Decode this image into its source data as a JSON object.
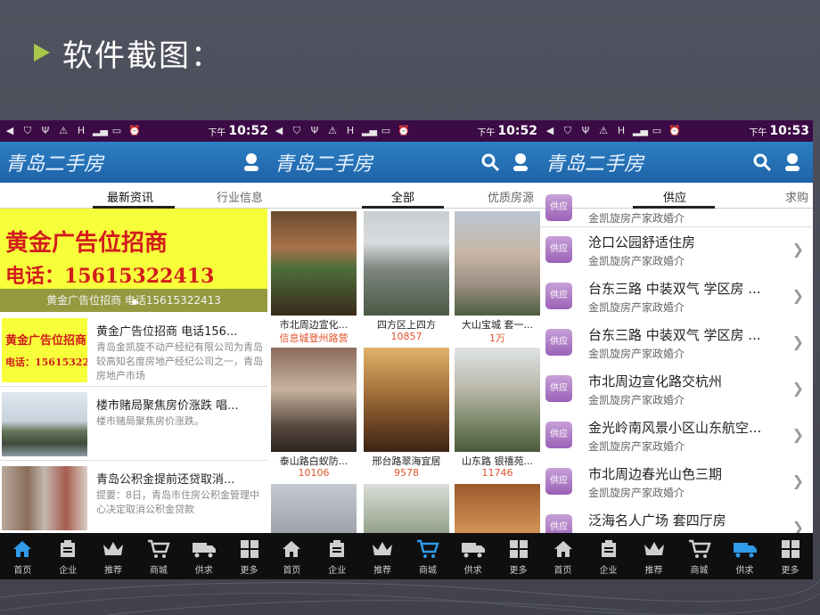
{
  "slide": {
    "title": "软件截图："
  },
  "status": {
    "ampm": "下午",
    "times": [
      "10:52",
      "10:52",
      "10:53"
    ]
  },
  "app": {
    "title": "青岛二手房"
  },
  "phone1": {
    "tabs": [
      "最新资讯",
      "行业信息"
    ],
    "banner": {
      "line1": "黄金广告位招商",
      "line2": "电话：15615322413",
      "caption": "黄金广告位招商 电话15615322413"
    },
    "news": [
      {
        "title": "黄金广告位招商 电话156...",
        "desc": "青岛金凯旋不动产经纪有限公司为青岛较高知名度房地产经纪公司之一，青岛房地产市场",
        "thumb_l1": "黄金广告位招商",
        "thumb_l2": "电话：15615322413"
      },
      {
        "title": "楼市赌局聚焦房价涨跌 唱...",
        "desc": "楼市赌局聚焦房价涨跌。"
      },
      {
        "title": "青岛公积金提前还贷取消...",
        "desc": "提要：8日，青岛市住房公积金管理中心决定取消公积金贷款"
      }
    ]
  },
  "phone2": {
    "tabs": [
      "全部",
      "优质房源"
    ],
    "items": [
      {
        "title": "市北周边宣化...",
        "price": "信息城登州路营"
      },
      {
        "title": "四方区上四方",
        "price": "10857"
      },
      {
        "title": "大山宝城 套一...",
        "price": "1万"
      },
      {
        "title": "泰山路白蚁防...",
        "price": "10106"
      },
      {
        "title": "邢台路翠海宜居",
        "price": "9578"
      },
      {
        "title": "山东路 银禧苑...",
        "price": "11746"
      }
    ]
  },
  "phone3": {
    "tabs": [
      "供应",
      "求购"
    ],
    "badge": "供应",
    "top_sub": "金凯旋房产家政婚介",
    "items": [
      {
        "title": "沧口公园舒适住房",
        "sub": "金凯旋房产家政婚介"
      },
      {
        "title": "台东三路 中装双气 学区房 ...",
        "sub": "金凯旋房产家政婚介"
      },
      {
        "title": "台东三路 中装双气 学区房 ...",
        "sub": "金凯旋房产家政婚介"
      },
      {
        "title": "市北周边宣化路交杭州",
        "sub": "金凯旋房产家政婚介"
      },
      {
        "title": "金光岭南风景小区山东航空...",
        "sub": "金凯旋房产家政婚介"
      },
      {
        "title": "市北周边春光山色三期",
        "sub": "金凯旋房产家政婚介"
      },
      {
        "title": "泛海名人广场 套四厅房",
        "sub": ""
      }
    ]
  },
  "nav": {
    "items": [
      {
        "label": "首页",
        "icon": "home-icon"
      },
      {
        "label": "企业",
        "icon": "company-icon"
      },
      {
        "label": "推荐",
        "icon": "crown-icon"
      },
      {
        "label": "商城",
        "icon": "cart-icon"
      },
      {
        "label": "供求",
        "icon": "truck-icon"
      },
      {
        "label": "更多",
        "icon": "grid-icon"
      }
    ],
    "active_color": "#2f9be8",
    "inactive_color": "#cfcfcf"
  }
}
